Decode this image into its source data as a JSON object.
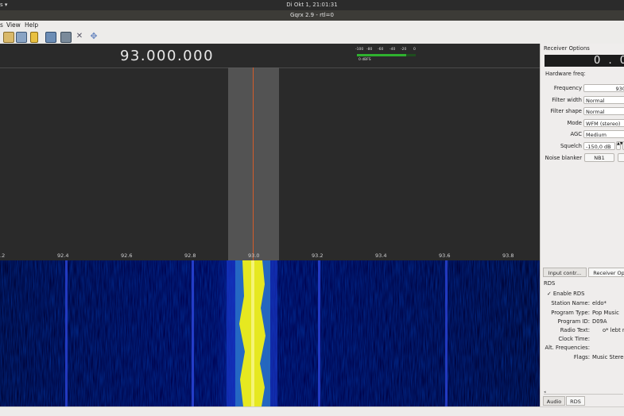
{
  "system": {
    "activities": "s ▾",
    "clock": "Di Okt  1, 21:01:31"
  },
  "window": {
    "title": "Gqrx 2.9 - rtl=0"
  },
  "menu": {
    "file": "s",
    "view": "View",
    "help": "Help"
  },
  "plot": {
    "frequency_display": "93.000.000",
    "meter_ticks": [
      "-100",
      "-80",
      "-60",
      "-40",
      "-20",
      "0"
    ],
    "meter_unit": "0 dBFS",
    "signal_level_fraction": 0.84,
    "ticks": [
      ".2",
      "92.4",
      "92.6",
      "92.8",
      "93.0",
      "93.2",
      "93.4",
      "93.6",
      "93.8"
    ]
  },
  "receiver": {
    "title": "Receiver Options",
    "lcd": "0 . 0",
    "hardware_freq_label": "Hardware freq:",
    "frequency_label": "Frequency",
    "frequency_value": "9300",
    "filter_width_label": "Filter width",
    "filter_width_value": "Normal",
    "filter_shape_label": "Filter shape",
    "filter_shape_value": "Normal",
    "mode_label": "Mode",
    "mode_value": "WFM (stereo)",
    "agc_label": "AGC",
    "agc_value": "Medium",
    "squelch_label": "Squelch",
    "squelch_value": "-150,0 dB",
    "noise_blanker_label": "Noise blanker",
    "nb1": "NB1"
  },
  "tabs": {
    "input": "Input contr...",
    "receiver": "Receiver Op"
  },
  "rds": {
    "title": "RDS",
    "enable_label": "Enable RDS",
    "station_name_label": "Station Name:",
    "station_name": "eldo*",
    "program_type_label": "Program Type:",
    "program_type": "Pop Music",
    "program_id_label": "Program ID:",
    "program_id": "D09A",
    "radio_text_label": "Radio Text:",
    "radio_text": "o* lebt n",
    "clock_time_label": "Clock Time:",
    "alt_freq_label": "Alt. Frequencies:",
    "flags_label": "Flags:",
    "flags": "Music Stereo"
  },
  "bottom_tabs": {
    "audio": "Audio",
    "rds": "RDS"
  },
  "colors": {
    "accent_center": "#d35c2a",
    "meter_green": "#2fb12f",
    "waterfall_bg": "#000024"
  }
}
